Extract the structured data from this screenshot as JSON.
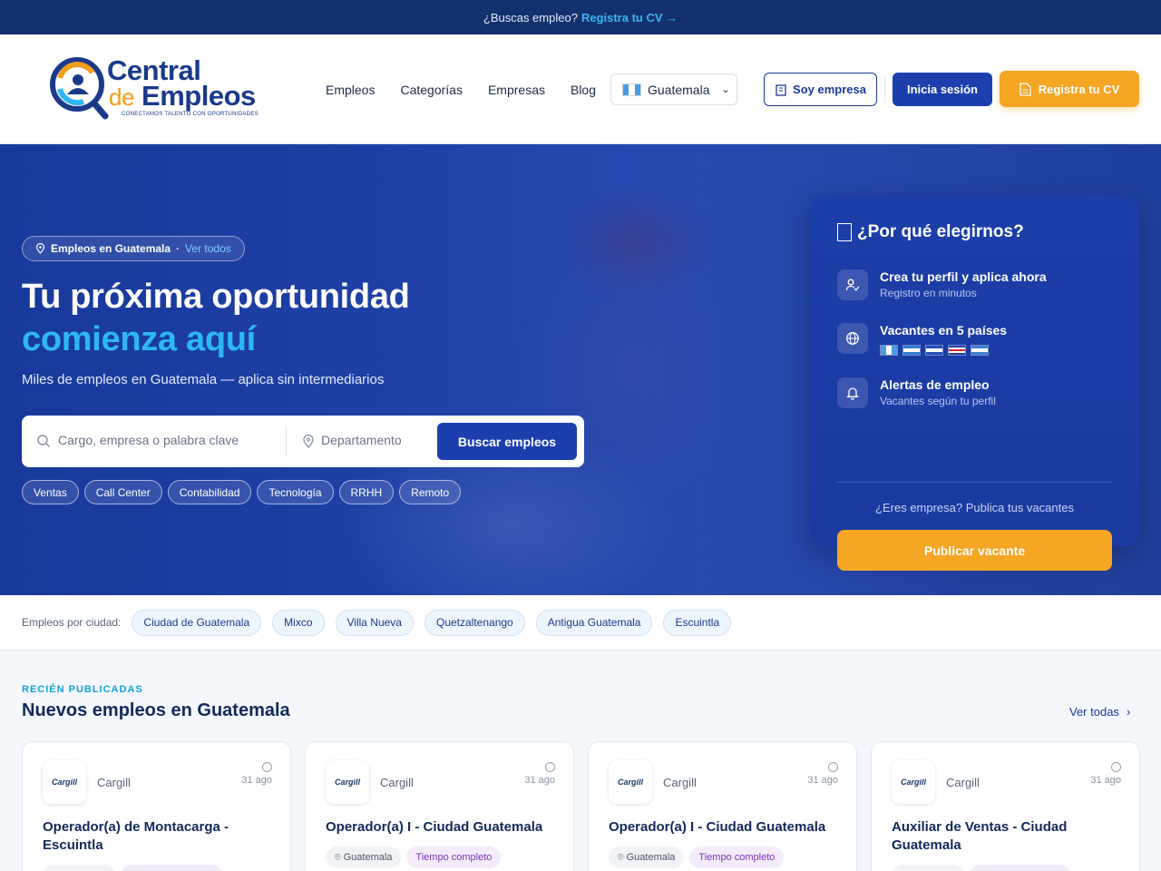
{
  "topbar": {
    "text": "¿Buscas empleo?",
    "link": "Registra tu CV →"
  },
  "header": {
    "logo": {
      "line1": "Central",
      "de": "de",
      "line2": "Empleos",
      "tagline": "CONECTAMOS TALENTO CON OPORTUNIDADES"
    },
    "nav": [
      "Empleos",
      "Categorías",
      "Empresas",
      "Blog"
    ],
    "country": "Guatemala",
    "empresa_button": "Soy empresa",
    "login_button": "Inicia sesión",
    "cv_button": "Registra tu CV"
  },
  "hero": {
    "location_pill": {
      "label": "Empleos en Guatemala",
      "separator": "·",
      "link": "Ver todos"
    },
    "title_line1": "Tu próxima oportunidad",
    "title_line2": "comienza aquí",
    "subtitle": "Miles de empleos en Guatemala — aplica sin intermediarios",
    "search": {
      "keyword_placeholder": "Cargo, empresa o palabra clave",
      "department_placeholder": "Departamento",
      "button": "Buscar empleos"
    },
    "chips": [
      "Ventas",
      "Call Center",
      "Contabilidad",
      "Tecnología",
      "RRHH",
      "Remoto"
    ]
  },
  "why": {
    "title": "¿Por qué elegirnos?",
    "items": [
      {
        "title": "Crea tu perfil y aplica ahora",
        "sub": "Registro en minutos",
        "icon": "user-check-icon"
      },
      {
        "title": "Vacantes en 5 países",
        "sub": "",
        "icon": "globe-icon"
      },
      {
        "title": "Alertas de empleo",
        "sub": "Vacantes según tu perfil",
        "icon": "bell-icon"
      }
    ],
    "question": "¿Eres empresa? Publica tus vacantes",
    "button": "Publicar vacante"
  },
  "cities": {
    "label": "Empleos por ciudad:",
    "items": [
      "Ciudad de Guatemala",
      "Mixco",
      "Villa Nueva",
      "Quetzaltenango",
      "Antigua Guatemala",
      "Escuintla"
    ]
  },
  "jobs": {
    "kicker": "RECIÉN PUBLICADAS",
    "title": "Nuevos empleos en Guatemala",
    "see_all": "Ver todas",
    "see_all_arrow": "›",
    "cards": [
      {
        "logo": "Cargill",
        "company": "Cargill",
        "ago": "31 ago",
        "title": "Operador(a) de Montacarga - Escuintla",
        "location": "",
        "type": ""
      },
      {
        "logo": "Cargill",
        "company": "Cargill",
        "ago": "31 ago",
        "title": "Operador(a) I - Ciudad Guatemala",
        "location": "Guatemala",
        "type": "Tiempo completo"
      },
      {
        "logo": "Cargill",
        "company": "Cargill",
        "ago": "31 ago",
        "title": "Operador(a) I - Ciudad Guatemala",
        "location": "Guatemala",
        "type": "Tiempo completo"
      },
      {
        "logo": "Cargill",
        "company": "Cargill",
        "ago": "31 ago",
        "title": "Auxiliar de Ventas - Ciudad Guatemala",
        "location": "",
        "type": ""
      }
    ]
  },
  "colors": {
    "navy": "#13316e",
    "primary": "#1c3fae",
    "accent": "#f5a623",
    "cyan": "#2db7f5"
  }
}
